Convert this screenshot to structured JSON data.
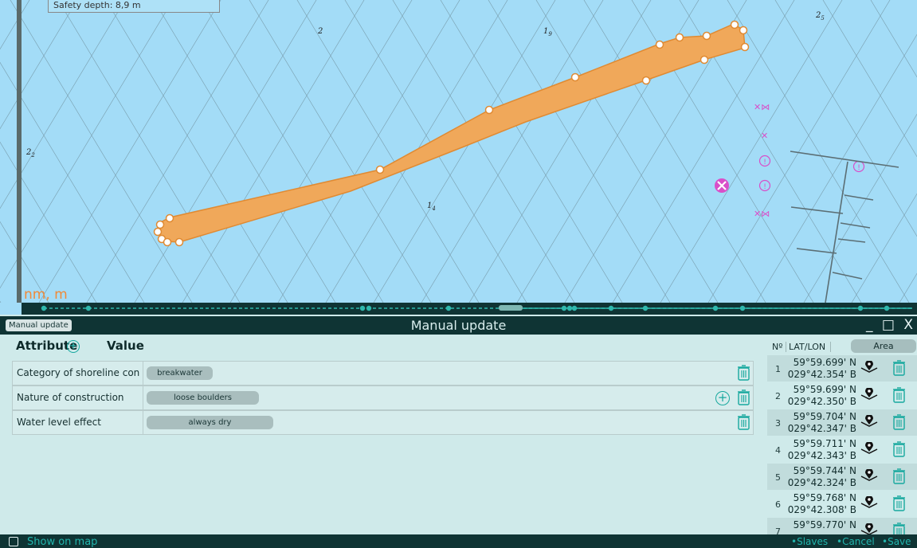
{
  "map": {
    "safety_depth": "Safety depth: 8,9 m",
    "units": "nm, m",
    "soundings": [
      {
        "label": "2",
        "sub": ""
      },
      {
        "label": "1",
        "sub": "9"
      },
      {
        "label": "2",
        "sub": "5"
      },
      {
        "label": "2",
        "sub": "2"
      },
      {
        "label": "1",
        "sub": "4"
      }
    ]
  },
  "panel": {
    "tag": "Manual update",
    "title": "Manual update",
    "window_controls": "_ □ X"
  },
  "attributes": {
    "attribute_header": "Attribute",
    "value_header": "Value",
    "rows": [
      {
        "name": "Category of shoreline con...",
        "value": "breakwater"
      },
      {
        "name": "Nature of construction",
        "value": "loose boulders"
      },
      {
        "name": "Water level effect",
        "value": "always dry"
      }
    ]
  },
  "coords": {
    "num_header": "Nº",
    "latlon_header": "LAT/LON",
    "area_button": "Area",
    "rows": [
      {
        "n": "1",
        "lat": "59°59.699' N",
        "lon": "029°42.354' B"
      },
      {
        "n": "2",
        "lat": "59°59.699' N",
        "lon": "029°42.350' B"
      },
      {
        "n": "3",
        "lat": "59°59.704' N",
        "lon": "029°42.347' B"
      },
      {
        "n": "4",
        "lat": "59°59.711' N",
        "lon": "029°42.343' B"
      },
      {
        "n": "5",
        "lat": "59°59.744' N",
        "lon": "029°42.324' B"
      },
      {
        "n": "6",
        "lat": "59°59.768' N",
        "lon": "029°42.308' B"
      },
      {
        "n": "7",
        "lat": "59°59.770' N",
        "lon": ""
      }
    ]
  },
  "footer": {
    "show_on_map": "Show on map",
    "slaves": "•Slaves",
    "cancel": "•Cancel",
    "save": "•Save"
  },
  "colors": {
    "sea": "#a3dcf7",
    "breakwater_fill": "#f0a85a",
    "accent": "#17a89e",
    "panel_dark": "#0f3434",
    "panel_bg": "#cfeaea",
    "danger_symbol": "#d94fc9"
  }
}
